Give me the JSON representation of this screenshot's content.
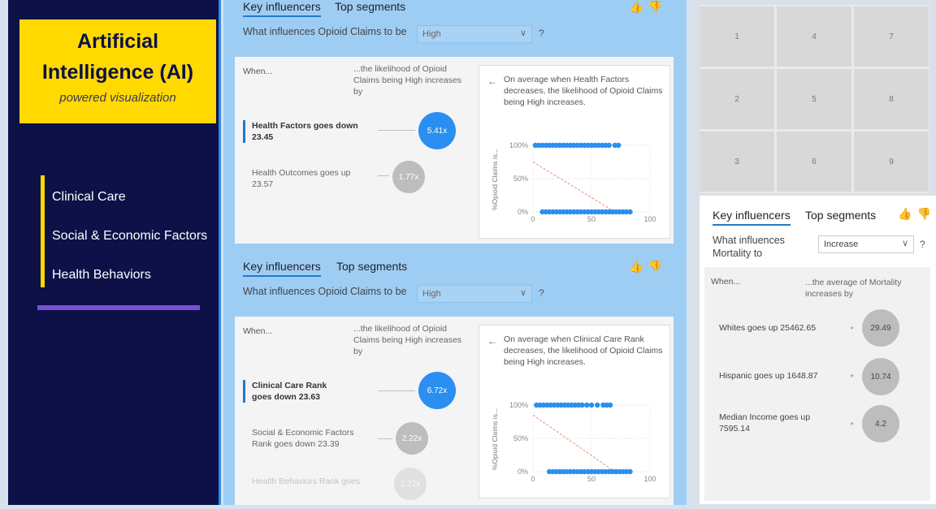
{
  "nav": {
    "title_line1": "Artificial",
    "title_line2": "Intelligence (AI)",
    "subtitle": "powered visualization",
    "items": [
      {
        "label": "Clinical Care"
      },
      {
        "label": "Social & Economic Factors"
      },
      {
        "label": "Health Behaviors"
      }
    ]
  },
  "colors": {
    "nav_bg": "#0d1147",
    "title_yellow": "#ffd900",
    "accent_blue": "#2a8ff0",
    "purple": "#7a4ed6",
    "center_bg": "#9ecdf4"
  },
  "ki1": {
    "tab_active": "Key influencers",
    "tab_other": "Top segments",
    "thumbs_up": "👍",
    "thumbs_down": "👎",
    "prompt": "What influences Opioid Claims to be",
    "dropdown_value": "High",
    "help": "?",
    "when": "When...",
    "likelihood": "...the likelihood of Opioid Claims being High increases by",
    "factors": [
      {
        "label": "Health Factors goes down 23.45",
        "value": "5.41x"
      },
      {
        "label": "Health Outcomes goes up 23.57",
        "value": "1.77x"
      }
    ],
    "panel_text": "On average when Health Factors decreases, the likelihood of Opioid Claims being High increases.",
    "back": "←"
  },
  "ki2": {
    "tab_active": "Key influencers",
    "tab_other": "Top segments",
    "thumbs_up": "👍",
    "thumbs_down": "👎",
    "prompt": "What influences Opioid Claims to be",
    "dropdown_value": "High",
    "help": "?",
    "when": "When...",
    "likelihood": "...the likelihood of Opioid Claims being High increases by",
    "factors": [
      {
        "label": "Clinical Care Rank goes down 23.63",
        "value": "6.72x"
      },
      {
        "label": "Social & Economic Factors Rank goes down 23.39",
        "value": "2.22x"
      },
      {
        "label": "Health Behaviors Rank goes",
        "value": "1.72x"
      }
    ],
    "panel_text": "On average when Clinical Care Rank decreases, the likelihood of Opioid Claims being High increases.",
    "back": "←"
  },
  "grid": {
    "cells": [
      "1",
      "4",
      "7",
      "2",
      "5",
      "8",
      "3",
      "6",
      "9"
    ]
  },
  "ki3": {
    "tab_active": "Key influencers",
    "tab_other": "Top segments",
    "thumbs_up": "👍",
    "thumbs_down": "👎",
    "prompt": "What influences Mortality to",
    "dropdown_value": "Increase",
    "help": "?",
    "when": "When...",
    "avg": "...the average of Mortality increases by",
    "factors": [
      {
        "label": "Whites goes up 25462.65",
        "value": "29.49"
      },
      {
        "label": "Hispanic goes up 1648.87",
        "value": "10.74"
      },
      {
        "label": "Median Income goes up 7595.14",
        "value": "4.2"
      }
    ],
    "arrow": "▸"
  },
  "chart_data": [
    {
      "type": "scatter",
      "title": "",
      "ylabel": "%Opioid Claims is...",
      "xlabel": "",
      "ylim": [
        0,
        100
      ],
      "xlim": [
        0,
        100
      ],
      "yticks": [
        "0%",
        "50%",
        "100%"
      ],
      "xticks": [
        "0",
        "50",
        "100"
      ],
      "grid": true,
      "series": [
        {
          "x": [
            2,
            5,
            8,
            11,
            14,
            17,
            20,
            23,
            26,
            29,
            32,
            35,
            38,
            41,
            44,
            47,
            50,
            53,
            56,
            59,
            62,
            65,
            70,
            73
          ],
          "y": [
            100,
            100,
            100,
            100,
            100,
            100,
            100,
            100,
            100,
            100,
            100,
            100,
            100,
            100,
            100,
            100,
            100,
            100,
            100,
            100,
            100,
            100,
            100,
            100
          ]
        },
        {
          "x": [
            8,
            11,
            14,
            17,
            20,
            23,
            26,
            29,
            32,
            35,
            38,
            41,
            44,
            47,
            50,
            53,
            56,
            59,
            62,
            65,
            68,
            71,
            74,
            77,
            80,
            83
          ],
          "y": [
            0,
            0,
            0,
            0,
            0,
            0,
            0,
            0,
            0,
            0,
            0,
            0,
            0,
            0,
            0,
            0,
            0,
            0,
            0,
            0,
            0,
            0,
            0,
            0,
            0,
            0
          ]
        }
      ],
      "trend": {
        "x": [
          0,
          70
        ],
        "y": [
          75,
          0
        ]
      }
    },
    {
      "type": "scatter",
      "title": "",
      "ylabel": "%Opioid Claims is...",
      "xlabel": "",
      "ylim": [
        0,
        100
      ],
      "xlim": [
        0,
        100
      ],
      "yticks": [
        "0%",
        "50%",
        "100%"
      ],
      "xticks": [
        "0",
        "50",
        "100"
      ],
      "grid": true,
      "series": [
        {
          "x": [
            3,
            6,
            9,
            12,
            15,
            18,
            21,
            24,
            27,
            30,
            33,
            36,
            39,
            42,
            46,
            50,
            55,
            60,
            63,
            66
          ],
          "y": [
            100,
            100,
            100,
            100,
            100,
            100,
            100,
            100,
            100,
            100,
            100,
            100,
            100,
            100,
            100,
            100,
            100,
            100,
            100,
            100
          ]
        },
        {
          "x": [
            14,
            17,
            20,
            23,
            26,
            29,
            32,
            35,
            38,
            41,
            44,
            47,
            50,
            53,
            56,
            59,
            62,
            65,
            68,
            71,
            74,
            77,
            80,
            83
          ],
          "y": [
            0,
            0,
            0,
            0,
            0,
            0,
            0,
            0,
            0,
            0,
            0,
            0,
            0,
            0,
            0,
            0,
            0,
            0,
            0,
            0,
            0,
            0,
            0,
            0
          ]
        }
      ],
      "trend": {
        "x": [
          0,
          70
        ],
        "y": [
          85,
          0
        ]
      }
    }
  ]
}
